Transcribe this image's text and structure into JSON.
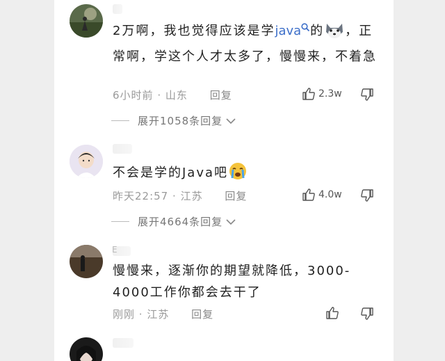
{
  "comments": [
    {
      "text_before": "2万啊，我也觉得应该是学",
      "link": "java",
      "text_after_link": "的",
      "text_after_emoji": "，正常啊，学这个人才太多了，慢慢来，不着急",
      "time": "6小时前",
      "location": "山东",
      "reply_label": "回复",
      "likes": "2.3w",
      "expand_label": "展开1058条回复"
    },
    {
      "text_before": "不会是学的Java吧",
      "time": "昨天22:57",
      "location": "江苏",
      "reply_label": "回复",
      "likes": "4.0w",
      "expand_label": "展开4664条回复"
    },
    {
      "username_initial": "E",
      "text_before": "慢慢来，逐渐你的期望就降低，3000-4000工作你都会去干了",
      "time": "刚刚",
      "location": "江苏",
      "reply_label": "回复"
    }
  ],
  "meta_separator": "·"
}
